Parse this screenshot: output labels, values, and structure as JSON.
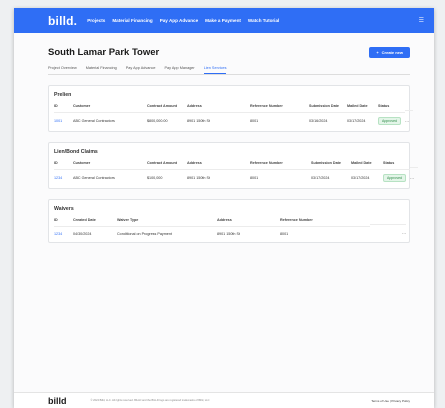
{
  "app": {
    "logo": "billd.",
    "nav": [
      "Projects",
      "Material Financing",
      "Pay App Advance",
      "Make a Payment",
      "Watch Tutorial"
    ],
    "menu_icon": "hamburger-menu-icon"
  },
  "page": {
    "title": "South Lamar Park Tower",
    "create_button": "Create new",
    "tabs": [
      "Project Overview",
      "Material Financing",
      "Pay App Advance",
      "Pay App Manager",
      "Lien Services"
    ],
    "active_tab": "Lien Services"
  },
  "prelien": {
    "title": "Prelien",
    "headers": [
      "ID",
      "Customer",
      "Contract Amount",
      "Address",
      "Reference Number",
      "Submission Date",
      "Mailed Date",
      "Status"
    ],
    "rows": [
      {
        "id": "1001",
        "customer": "ABC General Contractors",
        "amount": "$800,000.00",
        "address": "8901 150th St",
        "reference": "8001",
        "submission": "03/16/2024",
        "mailed": "03/17/2024",
        "status": "Approved"
      }
    ]
  },
  "bond": {
    "title": "Lien/Bond Claims",
    "headers": [
      "ID",
      "Customer",
      "Contract Amount",
      "Address",
      "Reference Number",
      "Submission Date",
      "Mailed Date",
      "Status"
    ],
    "rows": [
      {
        "id": "1234",
        "customer": "ABC General Contractors",
        "amount": "$100,000",
        "address": "8901 150th St",
        "reference": "8001",
        "submission": "03/17/2024",
        "mailed": "03/17/2024",
        "status": "Approved"
      }
    ]
  },
  "waivers": {
    "title": "Waivers",
    "headers": [
      "ID",
      "Created Date",
      "Waiver Type",
      "Address",
      "Reference Number"
    ],
    "rows": [
      {
        "id": "1234",
        "created": "04/30/2024",
        "type": "Conditional on Progress Payment",
        "address": "8901 150th St",
        "reference": "8001"
      }
    ]
  },
  "footer": {
    "logo": "billd",
    "copyright": "© 2024 Billd, LLC. All rights reserved. BILLD and the BILLD logo are registered trademarks of Billd, LLC",
    "links": "Terms of Use | Privacy Policy"
  }
}
